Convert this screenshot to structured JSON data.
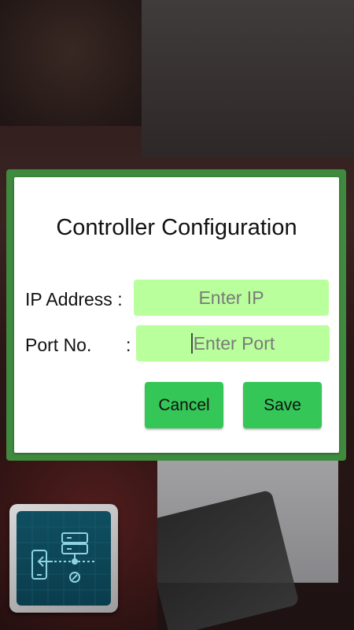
{
  "dialog": {
    "title": "Controller Configuration",
    "ip_label": "IP Address :",
    "ip_placeholder": "Enter IP",
    "port_label": "Port No.",
    "port_colon": ":",
    "port_placeholder": "Enter Port",
    "cancel_label": "Cancel",
    "save_label": "Save"
  },
  "floating_button": {
    "icon": "phone-to-server-connection-icon"
  },
  "colors": {
    "dialog_border": "#3f8a3f",
    "input_background": "#b9ff9c",
    "button_background": "#35c658"
  }
}
